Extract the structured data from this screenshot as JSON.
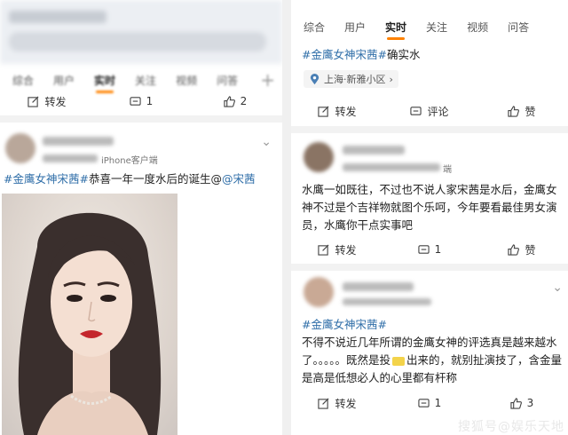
{
  "left": {
    "tabs": [
      "综合",
      "用户",
      "实时",
      "关注",
      "视频",
      "问答"
    ],
    "active_tab": "实时",
    "plus": "+",
    "actions": {
      "repost": "转发",
      "comment_count": "1",
      "like_count": "2"
    },
    "post": {
      "meta": "iPhone客户端",
      "tag": "#金鹰女神宋茜#",
      "text": "恭喜一年一度水后的诞生@",
      "mention": "@宋茜"
    }
  },
  "right": {
    "tabs": [
      "综合",
      "用户",
      "实时",
      "关注",
      "视频",
      "问答"
    ],
    "active_tab": "实时",
    "top_post": {
      "tag": "#金鹰女神宋茜#",
      "text": "确实水",
      "location": "上海·新雅小区",
      "location_arrow": "›"
    },
    "top_actions": {
      "repost": "转发",
      "comment": "评论",
      "like": "赞"
    },
    "post2": {
      "meta_suffix": "端",
      "text": "水鹰一如既往，不过也不说人家宋茜是水后，金鹰女神不过是个吉祥物就图个乐呵，今年要看最佳男女演员，水鹰你干点实事吧",
      "actions": {
        "repost": "转发",
        "comment_count": "1",
        "like": "赞"
      }
    },
    "post3": {
      "tag": "#金鹰女神宋茜#",
      "text": "不得不说近几年所谓的金鹰女神的评选真是越来越水了。。。。。既然是投",
      "text2": "出来的，就别扯演技了，含金量是高是低想必人的心里都有杆称",
      "actions": {
        "repost": "转发",
        "comment_count": "1",
        "like_count": "3"
      }
    },
    "watermark": "搜狐号@娱乐天地"
  },
  "colors": {
    "accent": "#ff8200",
    "link": "#2f6ea8"
  }
}
